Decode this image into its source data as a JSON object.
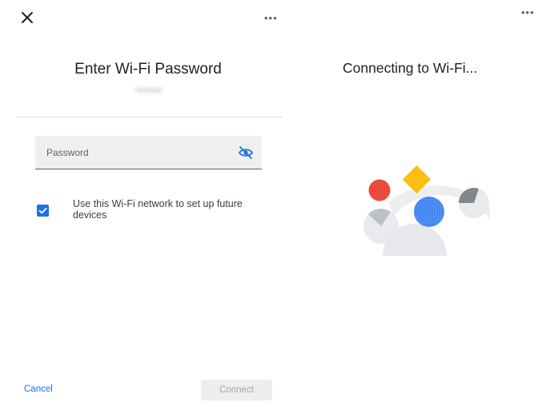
{
  "left_screen": {
    "title": "Enter Wi-Fi Password",
    "network_name": "••••••••",
    "password": {
      "placeholder": "Password",
      "value": ""
    },
    "checkbox": {
      "checked": true,
      "label": "Use this Wi-Fi network to set up future devices"
    },
    "cancel_label": "Cancel",
    "connect_label": "Connect",
    "icons": {
      "close": "close-icon",
      "more": "more-horiz-icon",
      "visibility": "visibility-off-icon"
    }
  },
  "right_screen": {
    "status": "Connecting to Wi-Fi...",
    "icons": {
      "more": "more-horiz-icon"
    }
  },
  "colors": {
    "accent": "#1a73e8",
    "red": "#ea4335",
    "yellow": "#fbbc04",
    "blue": "#4285f4",
    "gray_shape": "#e8eaed"
  }
}
